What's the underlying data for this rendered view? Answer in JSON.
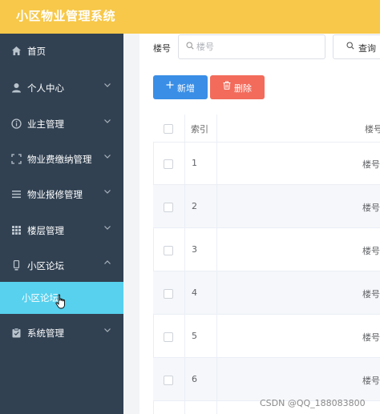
{
  "app": {
    "title": "小区物业管理系统"
  },
  "sidebar": {
    "items": [
      {
        "label": "首页",
        "icon": "home-icon",
        "glyph": "⌂",
        "expandable": false
      },
      {
        "label": "个人中心",
        "icon": "user-icon",
        "glyph": "●",
        "expandable": true
      },
      {
        "label": "业主管理",
        "icon": "info-icon",
        "glyph": "ⓘ",
        "expandable": true
      },
      {
        "label": "物业费缴纳管理",
        "icon": "fullscreen-icon",
        "glyph": "⛶",
        "expandable": true
      },
      {
        "label": "物业报修管理",
        "icon": "list-icon",
        "glyph": "☰",
        "expandable": true
      },
      {
        "label": "楼层管理",
        "icon": "grid-icon",
        "glyph": "▦",
        "expandable": true
      },
      {
        "label": "小区论坛",
        "icon": "phone-icon",
        "glyph": "▯",
        "expandable": true,
        "expanded": true
      },
      {
        "label": "系统管理",
        "icon": "clipboard-icon",
        "glyph": "▣",
        "expandable": true
      }
    ],
    "active_subitem": {
      "label": "小区论坛"
    }
  },
  "search": {
    "label": "楼号",
    "placeholder": "楼号",
    "value": "",
    "query_label": "查询"
  },
  "toolbar": {
    "add_label": "新增",
    "delete_label": "删除"
  },
  "table": {
    "columns": [
      "",
      "索引",
      "楼号"
    ],
    "rows": [
      {
        "index": "1",
        "building": "楼号"
      },
      {
        "index": "2",
        "building": "楼号"
      },
      {
        "index": "3",
        "building": "楼号"
      },
      {
        "index": "4",
        "building": "楼号"
      },
      {
        "index": "5",
        "building": "楼号"
      },
      {
        "index": "6",
        "building": "楼号"
      }
    ]
  },
  "watermark": "CSDN @QQ_188083800",
  "colors": {
    "topbar": "#f7c849",
    "sidebar": "#314152",
    "active_submenu": "#57d1ee",
    "add_button": "#3a8ee6",
    "delete_button": "#f26b5b"
  }
}
